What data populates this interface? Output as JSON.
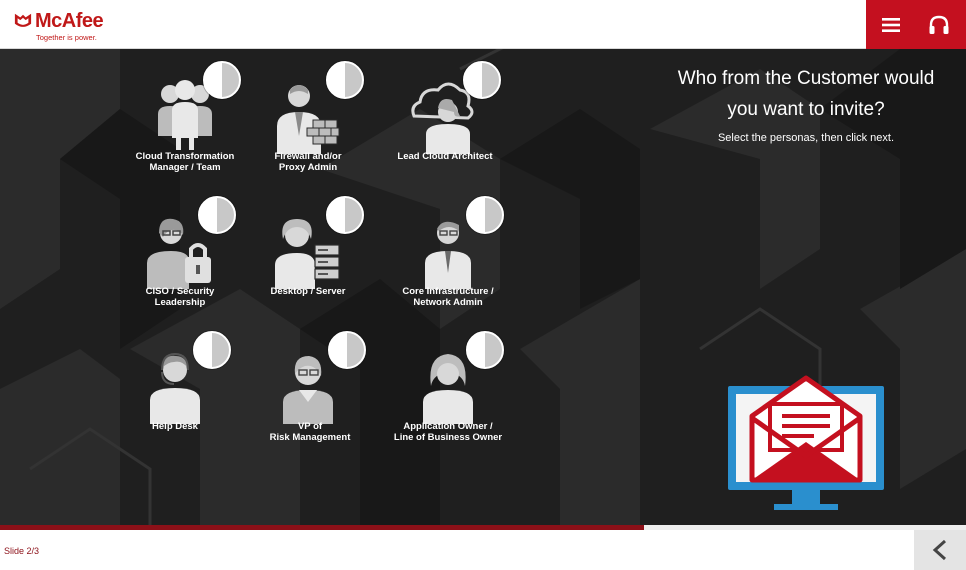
{
  "header": {
    "brand": "McAfee",
    "tagline": "Together is power.",
    "menu_icon": "hamburger-menu-icon",
    "support_icon": "headset-icon",
    "accent": "#c4101f"
  },
  "question": {
    "title": "Who from the Customer would you want to invite?",
    "instruction": "Select the personas, then click next."
  },
  "personas": [
    {
      "label_lines": [
        "Cloud Transformation",
        "Manager / Team"
      ],
      "icon": "team-group-icon",
      "selected": false
    },
    {
      "label_lines": [
        "Firewall and/or",
        "Proxy Admin"
      ],
      "icon": "firewall-admin-icon",
      "selected": false
    },
    {
      "label_lines": [
        "Lead Cloud Architect"
      ],
      "icon": "cloud-architect-icon",
      "selected": false
    },
    {
      "label_lines": [
        "CISO / Security",
        "Leadership"
      ],
      "icon": "security-lock-person-icon",
      "selected": false
    },
    {
      "label_lines": [
        "Desktop / Server"
      ],
      "icon": "server-person-icon",
      "selected": false
    },
    {
      "label_lines": [
        "Core Infrastructure /",
        "Network Admin"
      ],
      "icon": "network-admin-icon",
      "selected": false
    },
    {
      "label_lines": [
        "Help Desk"
      ],
      "icon": "headset-person-icon",
      "selected": false
    },
    {
      "label_lines": [
        "VP of",
        "Risk Management"
      ],
      "icon": "executive-person-icon",
      "selected": false
    },
    {
      "label_lines": [
        "Application Owner /",
        "Line of Business Owner"
      ],
      "icon": "business-owner-icon",
      "selected": false
    }
  ],
  "illustration": {
    "icon": "email-invite-monitor-icon",
    "colors": {
      "monitor": "#2a8fce",
      "envelope": "#c4101f"
    }
  },
  "progress": {
    "value": 0.667,
    "color": "#8c1018"
  },
  "footer": {
    "slide_counter": "Slide 2/3",
    "back_icon": "chevron-left-icon"
  }
}
